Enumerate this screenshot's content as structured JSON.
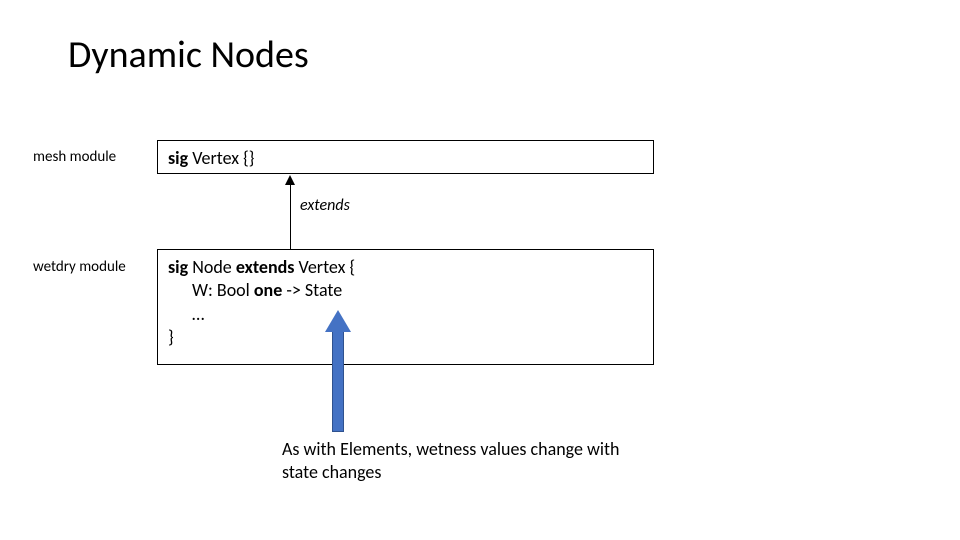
{
  "title": "Dynamic Nodes",
  "labels": {
    "mesh": "mesh module",
    "wetdry": "wetdry module",
    "extends": "extends"
  },
  "box1": {
    "sig": "sig",
    "rest": " Vertex {}"
  },
  "box2": {
    "sig": "sig",
    "after_sig": " Node ",
    "extends": "extends",
    "after_extends": " Vertex {",
    "line2a": "W: Bool ",
    "line2b": "one",
    "line2c": " -> State",
    "line3": "…",
    "line4": "}"
  },
  "caption": "As with Elements, wetness values change with state changes"
}
